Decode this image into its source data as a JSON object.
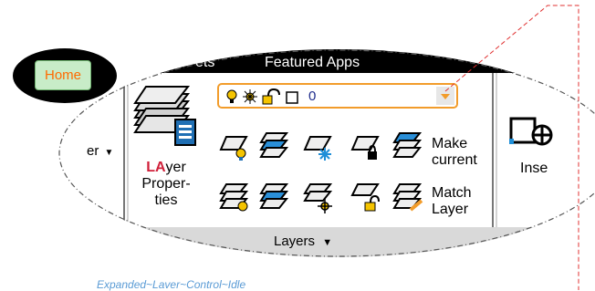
{
  "home_tab": {
    "label": "Home"
  },
  "ribbon": {
    "tabs": [
      "ets",
      "Featured Apps"
    ],
    "left_label": "er",
    "right_label": "Inse"
  },
  "layer_props": {
    "prefix": "LA",
    "rest": "yer",
    "line2": "Proper-",
    "line3": "ties"
  },
  "layer_dropdown": {
    "value": "0"
  },
  "make_current": {
    "line1": "Make",
    "line2": "current"
  },
  "match_layer": {
    "line1": "Match",
    "line2": "Layer"
  },
  "panel": {
    "title": "Layers"
  },
  "caption": "Expanded~Laver~Control~Idle",
  "colors": {
    "accent": "#f29c2b",
    "home_text": "#ff6a00",
    "caption": "#5a9bd5",
    "leader": "#e03030"
  }
}
